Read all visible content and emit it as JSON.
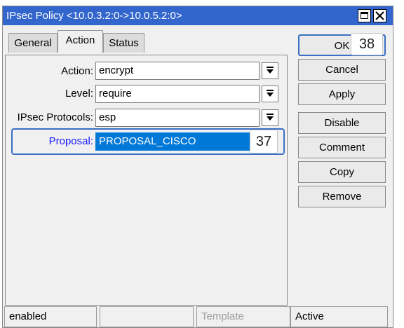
{
  "window": {
    "title": "IPsec Policy <10.0.3.2:0->10.0.5.2:0>"
  },
  "tabs": [
    {
      "label": "General"
    },
    {
      "label": "Action"
    },
    {
      "label": "Status"
    }
  ],
  "form": {
    "action": {
      "label": "Action:",
      "value": "encrypt"
    },
    "level": {
      "label": "Level:",
      "value": "require"
    },
    "protocols": {
      "label": "IPsec Protocols:",
      "value": "esp"
    },
    "proposal": {
      "label": "Proposal:",
      "value": "PROPOSAL_CISCO"
    }
  },
  "buttons": {
    "ok": "OK",
    "cancel": "Cancel",
    "apply": "Apply",
    "disable": "Disable",
    "comment": "Comment",
    "copy": "Copy",
    "remove": "Remove"
  },
  "annotations": {
    "proposal_marker": "37",
    "ok_marker": "38"
  },
  "statusbar": {
    "state": "enabled",
    "empty": "",
    "template": "Template",
    "active": "Active"
  },
  "colors": {
    "titlebar": "#3366cc",
    "focus_border": "#3a6fc4",
    "selection": "#0078d7",
    "proposal_label": "#1a1aff"
  }
}
